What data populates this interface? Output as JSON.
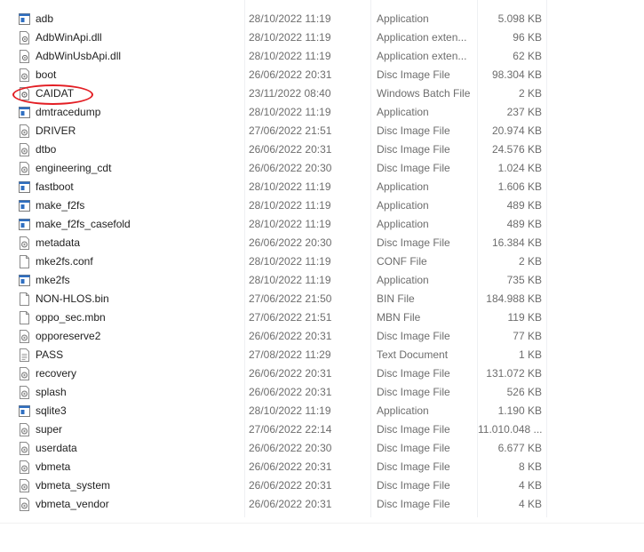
{
  "files": [
    {
      "name": "adb",
      "date": "28/10/2022 11:19",
      "type": "Application",
      "size": "5.098 KB",
      "icon": "application-icon"
    },
    {
      "name": "AdbWinApi.dll",
      "date": "28/10/2022 11:19",
      "type": "Application exten...",
      "size": "96 KB",
      "icon": "dll-icon"
    },
    {
      "name": "AdbWinUsbApi.dll",
      "date": "28/10/2022 11:19",
      "type": "Application exten...",
      "size": "62 KB",
      "icon": "dll-icon"
    },
    {
      "name": "boot",
      "date": "26/06/2022 20:31",
      "type": "Disc Image File",
      "size": "98.304 KB",
      "icon": "disc-image-icon"
    },
    {
      "name": "CAIDAT",
      "date": "23/11/2022 08:40",
      "type": "Windows Batch File",
      "size": "2 KB",
      "icon": "batch-file-icon"
    },
    {
      "name": "dmtracedump",
      "date": "28/10/2022 11:19",
      "type": "Application",
      "size": "237 KB",
      "icon": "application-icon"
    },
    {
      "name": "DRIVER",
      "date": "27/06/2022 21:51",
      "type": "Disc Image File",
      "size": "20.974 KB",
      "icon": "disc-image-icon"
    },
    {
      "name": "dtbo",
      "date": "26/06/2022 20:31",
      "type": "Disc Image File",
      "size": "24.576 KB",
      "icon": "disc-image-icon"
    },
    {
      "name": "engineering_cdt",
      "date": "26/06/2022 20:30",
      "type": "Disc Image File",
      "size": "1.024 KB",
      "icon": "disc-image-icon"
    },
    {
      "name": "fastboot",
      "date": "28/10/2022 11:19",
      "type": "Application",
      "size": "1.606 KB",
      "icon": "application-icon"
    },
    {
      "name": "make_f2fs",
      "date": "28/10/2022 11:19",
      "type": "Application",
      "size": "489 KB",
      "icon": "application-icon"
    },
    {
      "name": "make_f2fs_casefold",
      "date": "28/10/2022 11:19",
      "type": "Application",
      "size": "489 KB",
      "icon": "application-icon"
    },
    {
      "name": "metadata",
      "date": "26/06/2022 20:30",
      "type": "Disc Image File",
      "size": "16.384 KB",
      "icon": "disc-image-icon"
    },
    {
      "name": "mke2fs.conf",
      "date": "28/10/2022 11:19",
      "type": "CONF File",
      "size": "2 KB",
      "icon": "blank-file-icon"
    },
    {
      "name": "mke2fs",
      "date": "28/10/2022 11:19",
      "type": "Application",
      "size": "735 KB",
      "icon": "application-icon"
    },
    {
      "name": "NON-HLOS.bin",
      "date": "27/06/2022 21:50",
      "type": "BIN File",
      "size": "184.988 KB",
      "icon": "blank-file-icon"
    },
    {
      "name": "oppo_sec.mbn",
      "date": "27/06/2022 21:51",
      "type": "MBN File",
      "size": "119 KB",
      "icon": "blank-file-icon"
    },
    {
      "name": "opporeserve2",
      "date": "26/06/2022 20:31",
      "type": "Disc Image File",
      "size": "77 KB",
      "icon": "disc-image-icon"
    },
    {
      "name": "PASS",
      "date": "27/08/2022 11:29",
      "type": "Text Document",
      "size": "1 KB",
      "icon": "text-file-icon"
    },
    {
      "name": "recovery",
      "date": "26/06/2022 20:31",
      "type": "Disc Image File",
      "size": "131.072 KB",
      "icon": "disc-image-icon"
    },
    {
      "name": "splash",
      "date": "26/06/2022 20:31",
      "type": "Disc Image File",
      "size": "526 KB",
      "icon": "disc-image-icon"
    },
    {
      "name": "sqlite3",
      "date": "28/10/2022 11:19",
      "type": "Application",
      "size": "1.190 KB",
      "icon": "application-icon"
    },
    {
      "name": "super",
      "date": "27/06/2022 22:14",
      "type": "Disc Image File",
      "size": "11.010.048 ...",
      "icon": "disc-image-icon"
    },
    {
      "name": "userdata",
      "date": "26/06/2022 20:30",
      "type": "Disc Image File",
      "size": "6.677 KB",
      "icon": "disc-image-icon"
    },
    {
      "name": "vbmeta",
      "date": "26/06/2022 20:31",
      "type": "Disc Image File",
      "size": "8 KB",
      "icon": "disc-image-icon"
    },
    {
      "name": "vbmeta_system",
      "date": "26/06/2022 20:31",
      "type": "Disc Image File",
      "size": "4 KB",
      "icon": "disc-image-icon"
    },
    {
      "name": "vbmeta_vendor",
      "date": "26/06/2022 20:31",
      "type": "Disc Image File",
      "size": "4 KB",
      "icon": "disc-image-icon"
    }
  ],
  "colors": {
    "highlight_ellipse": "#e31e24",
    "app_icon_blue": "#2f6fc1",
    "secondary_text": "#6d6d6d"
  }
}
